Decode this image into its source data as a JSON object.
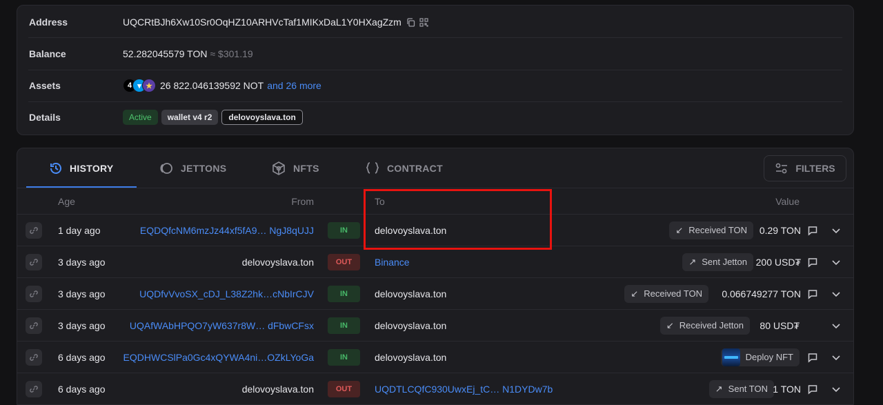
{
  "account": {
    "address_label": "Address",
    "address_value": "UQCRtBJh6Xw10Sr0OqHZ10ARHVcTaf1MIKxDaL1Y0HXagZzm",
    "balance_label": "Balance",
    "balance_value": "52.282045579 TON",
    "balance_fiat": "≈ $301.19",
    "assets_label": "Assets",
    "assets_icons": [
      "notcoin-icon",
      "ton-icon",
      "star-token-icon"
    ],
    "assets_value": "26 822.046139592 NOT",
    "assets_more": "and 26 more",
    "details_label": "Details",
    "badges": {
      "status": "Active",
      "wallet": "wallet v4 r2",
      "domain": "delovoyslava.ton"
    }
  },
  "tabs": [
    {
      "label": "HISTORY",
      "icon": "history-icon",
      "active": true
    },
    {
      "label": "JETTONS",
      "icon": "jetton-icon",
      "active": false
    },
    {
      "label": "NFTS",
      "icon": "nft-cube-icon",
      "active": false
    },
    {
      "label": "CONTRACT",
      "icon": "code-braces-icon",
      "active": false
    }
  ],
  "filters_label": "FILTERS",
  "table": {
    "headers": {
      "age": "Age",
      "from": "From",
      "to": "To",
      "value": "Value"
    },
    "rows": [
      {
        "age": "1 day ago",
        "from": "EQDQfcNM6mzJz44xf5fA9… NgJ8qUJJ",
        "from_link": true,
        "dir": "IN",
        "to": "delovoyslava.ton",
        "to_link": false,
        "type": "Received TON",
        "type_icon": "arrow-down-left",
        "amount": "0.29 TON",
        "comment": true
      },
      {
        "age": "3 days ago",
        "from": "delovoyslava.ton",
        "from_link": false,
        "dir": "OUT",
        "to": "Binance",
        "to_link": true,
        "type": "Sent Jetton",
        "type_icon": "arrow-up-right",
        "amount": "200 USD₮",
        "comment": true
      },
      {
        "age": "3 days ago",
        "from": "UQDfvVvoSX_cDJ_L38Z2hk…cNbIrCJV",
        "from_link": true,
        "dir": "IN",
        "to": "delovoyslava.ton",
        "to_link": false,
        "type": "Received TON",
        "type_icon": "arrow-down-left",
        "amount": "0.066749277 TON",
        "comment": true
      },
      {
        "age": "3 days ago",
        "from": "UQAfWAbHPQO7yW637r8W… dFbwCFsx",
        "from_link": true,
        "dir": "IN",
        "to": "delovoyslava.ton",
        "to_link": false,
        "type": "Received Jetton",
        "type_icon": "arrow-down-left",
        "amount": "80 USD₮",
        "comment": false
      },
      {
        "age": "6 days ago",
        "from": "EQDHWCSlPa0Gc4xQYWA4ni…OZkLYoGa",
        "from_link": true,
        "dir": "IN",
        "to": "delovoyslava.ton",
        "to_link": false,
        "type": "Deploy NFT",
        "type_icon": "nft-thumbnail",
        "amount": "",
        "comment": true
      },
      {
        "age": "6 days ago",
        "from": "delovoyslava.ton",
        "from_link": false,
        "dir": "OUT",
        "to": "UQDTLCQfC930UwxEj_tC… N1DYDw7b",
        "to_link": true,
        "type": "Sent TON",
        "type_icon": "arrow-up-right",
        "amount": "1 TON",
        "comment": true
      }
    ]
  },
  "colors": {
    "link": "#4a8cf7",
    "in_badge": "#47b868",
    "out_badge": "#e05a5a",
    "highlight": "#e8130f",
    "tab_active_underline": "#3d7de8"
  }
}
